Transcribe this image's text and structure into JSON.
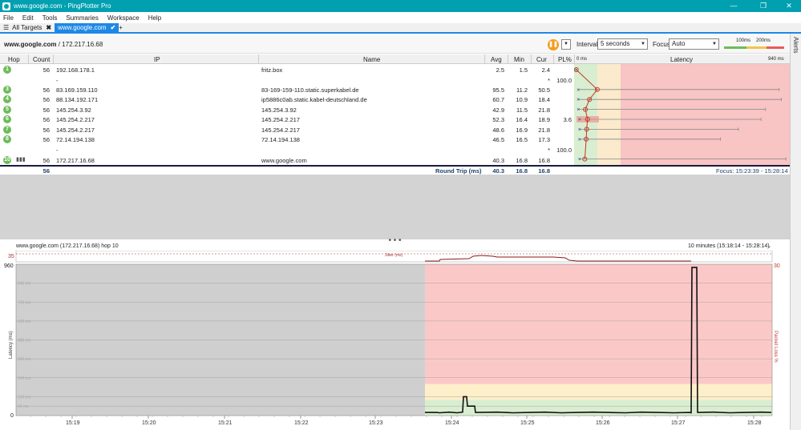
{
  "window": {
    "title": "www.google.com - PingPlotter Pro",
    "minimize": "—",
    "maximize": "❐",
    "close": "✕"
  },
  "menu": [
    "File",
    "Edit",
    "Tools",
    "Summaries",
    "Workspace",
    "Help"
  ],
  "tabs": {
    "all_targets": "All Targets",
    "active": "www.google.com",
    "add": "+"
  },
  "target": {
    "host": "www.google.com",
    "ip": "/ 172.217.16.68"
  },
  "controls": {
    "interval_label": "Interval",
    "interval_value": "5 seconds",
    "focus_label": "Focus",
    "focus_value": "Auto",
    "scale_100": "100ms",
    "scale_200": "200ms"
  },
  "alerts_label": "Alerts",
  "columns": {
    "hop": "Hop",
    "count": "Count",
    "ip": "IP",
    "name": "Name",
    "avg": "Avg",
    "min": "Min",
    "cur": "Cur",
    "pl": "PL%",
    "latency": "Latency",
    "lat_min": "0 ms",
    "lat_max": "940 ms"
  },
  "hops": [
    {
      "hop": "1",
      "count": "56",
      "ip": "192.168.178.1",
      "name": "fritz.box",
      "avg": "2.5",
      "min": "1.5",
      "cur": "2.4",
      "pl": "",
      "latency": 2.5,
      "max_latency": 2.4,
      "min_latency": 1.5
    },
    {
      "hop": "",
      "count": "",
      "ip": "-",
      "name": "",
      "avg": "",
      "min": "",
      "cur": "*",
      "pl": "100.0",
      "latency": null
    },
    {
      "hop": "3",
      "count": "56",
      "ip": "83.169.159.110",
      "name": "83-169-159-110.static.superkabel.de",
      "avg": "95.5",
      "min": "11.2",
      "cur": "50.5",
      "pl": "",
      "latency": 95.5,
      "max_latency": 900,
      "min_latency": 11.2
    },
    {
      "hop": "4",
      "count": "56",
      "ip": "88.134.192.171",
      "name": "ip5886c0ab.static.kabel-deutschland.de",
      "avg": "60.7",
      "min": "10.9",
      "cur": "18.4",
      "pl": "",
      "latency": 60.7,
      "max_latency": 910,
      "min_latency": 10.9
    },
    {
      "hop": "5",
      "count": "56",
      "ip": "145.254.3.92",
      "name": "145.254.3.92",
      "avg": "42.9",
      "min": "11.5",
      "cur": "21.8",
      "pl": "",
      "latency": 42.9,
      "max_latency": 840,
      "min_latency": 11.5
    },
    {
      "hop": "6",
      "count": "56",
      "ip": "145.254.2.217",
      "name": "145.254.2.217",
      "avg": "52.3",
      "min": "16.4",
      "cur": "18.9",
      "pl": "3.6",
      "latency": 52.3,
      "max_latency": 820,
      "min_latency": 16.4
    },
    {
      "hop": "7",
      "count": "56",
      "ip": "145.254.2.217",
      "name": "145.254.2.217",
      "avg": "48.6",
      "min": "16.9",
      "cur": "21.8",
      "pl": "",
      "latency": 48.6,
      "max_latency": 720,
      "min_latency": 16.9
    },
    {
      "hop": "8",
      "count": "56",
      "ip": "72.14.194.138",
      "name": "72.14.194.138",
      "avg": "46.5",
      "min": "16.5",
      "cur": "17.3",
      "pl": "",
      "latency": 46.5,
      "max_latency": 640,
      "min_latency": 16.5
    },
    {
      "hop": "",
      "count": "",
      "ip": "-",
      "name": "",
      "avg": "",
      "min": "",
      "cur": "*",
      "pl": "100.0",
      "latency": null
    },
    {
      "hop": "10",
      "count": "56",
      "ip": "172.217.16.68",
      "name": "www.google.com",
      "avg": "40.3",
      "min": "16.8",
      "cur": "16.8",
      "pl": "",
      "latency": 40.3,
      "max_latency": 930,
      "min_latency": 16.8
    }
  ],
  "summary": {
    "count": "56",
    "label": "Round Trip (ms)",
    "avg": "40.3",
    "min": "16.8",
    "cur": "16.8",
    "focus": "Focus: 15:23:39 - 15:28:14"
  },
  "graph": {
    "title": "www.google.com (172.217.16.68) hop 10",
    "range": "10 minutes (15:18:14 - 15:28:14)",
    "jitter_label": "Jitter (ms)",
    "jitter_max": "35",
    "y_max": "960",
    "y_min": "0",
    "y_label": "Latency (ms)",
    "pl_label": "Packet Loss %",
    "pl_max": "30",
    "y_ticks": [
      "840 ms",
      "720 ms",
      "600 ms",
      "480 ms",
      "360 ms",
      "240 ms",
      "120 ms",
      "60 ms"
    ],
    "x_ticks": [
      "15:19",
      "15:20",
      "15:21",
      "15:22",
      "15:23",
      "15:24",
      "15:25",
      "15:26",
      "15:27",
      "15:28"
    ]
  }
}
